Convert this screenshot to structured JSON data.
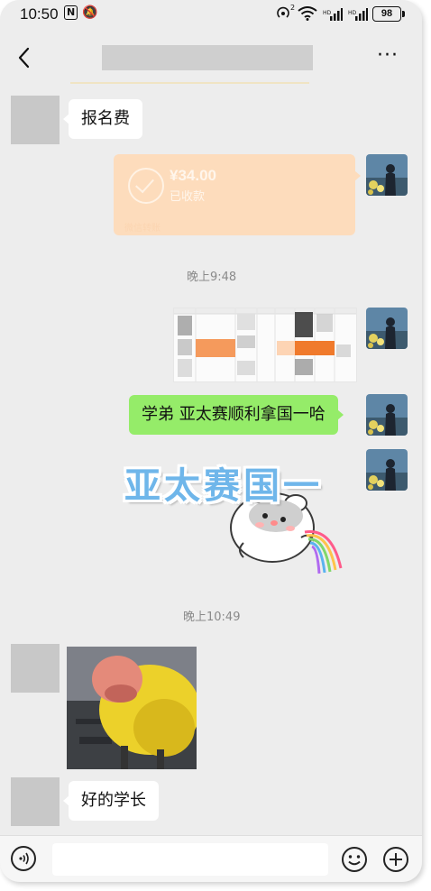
{
  "status_bar": {
    "time": "10:50",
    "nfc": "N",
    "mute": "🔕",
    "hotspot_sup": "2",
    "battery": "98"
  },
  "header": {
    "more": "···"
  },
  "messages": {
    "reg_fee": "报名费",
    "transfer": {
      "amount": "¥34.00",
      "status": "已收款",
      "label": "微信转账"
    },
    "time1": "晚上9:48",
    "green_text": "学弟 亚太赛顺利拿国一哈",
    "sticker_text": "亚太赛国一",
    "time2": "晚上10:49",
    "reply": "好的学长"
  },
  "input": {
    "placeholder": ""
  },
  "colors": {
    "background": "#ededed",
    "green_bubble": "#95ec69",
    "transfer": "#fddcbc",
    "sticker_text": "#6fb6ea"
  },
  "icons": {
    "back": "chevron-left-icon",
    "more": "more-icon",
    "voice": "voice-icon",
    "emoji": "emoji-icon",
    "plus": "plus-icon"
  }
}
